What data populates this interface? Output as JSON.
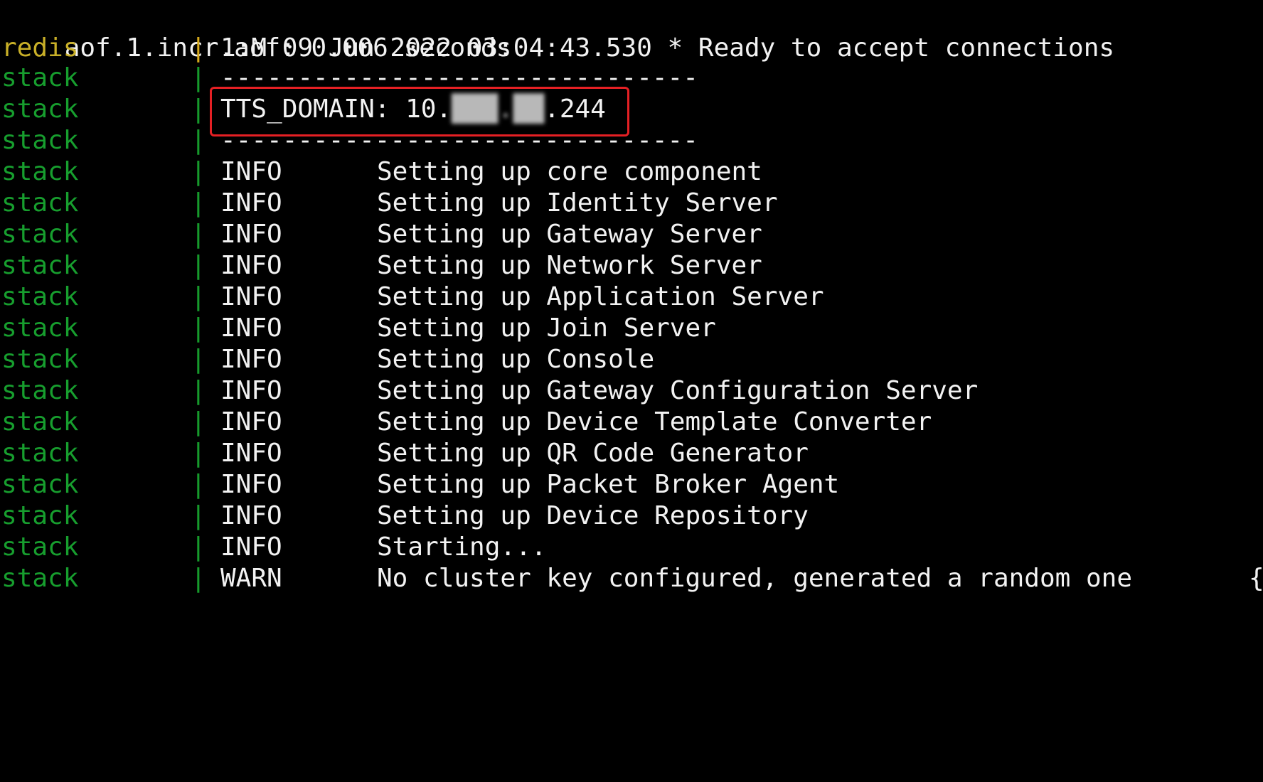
{
  "terminal": {
    "header_line": "aof.1.incr.aof: 0.006 seconds",
    "redis_line": {
      "service": "redis",
      "pipe": "|",
      "message": "1:M 09 Jun 2022 03:04:43.530 * Ready to accept connections"
    },
    "separator_top": {
      "service": "stack",
      "pipe": "|",
      "text": "-------------------------------"
    },
    "tts_line": {
      "service": "stack",
      "pipe": "|",
      "label": "TTS_DOMAIN: 10.",
      "redacted": "███.██",
      "suffix": ".244"
    },
    "separator_bottom": {
      "service": "stack",
      "pipe": "|",
      "text": "-------------------------------"
    },
    "log_lines": [
      {
        "service": "stack",
        "pipe": "|",
        "level": "INFO",
        "message": "Setting up core component"
      },
      {
        "service": "stack",
        "pipe": "|",
        "level": "INFO",
        "message": "Setting up Identity Server"
      },
      {
        "service": "stack",
        "pipe": "|",
        "level": "INFO",
        "message": "Setting up Gateway Server"
      },
      {
        "service": "stack",
        "pipe": "|",
        "level": "INFO",
        "message": "Setting up Network Server"
      },
      {
        "service": "stack",
        "pipe": "|",
        "level": "INFO",
        "message": "Setting up Application Server"
      },
      {
        "service": "stack",
        "pipe": "|",
        "level": "INFO",
        "message": "Setting up Join Server"
      },
      {
        "service": "stack",
        "pipe": "|",
        "level": "INFO",
        "message": "Setting up Console"
      },
      {
        "service": "stack",
        "pipe": "|",
        "level": "INFO",
        "message": "Setting up Gateway Configuration Server"
      },
      {
        "service": "stack",
        "pipe": "|",
        "level": "INFO",
        "message": "Setting up Device Template Converter"
      },
      {
        "service": "stack",
        "pipe": "|",
        "level": "INFO",
        "message": "Setting up QR Code Generator"
      },
      {
        "service": "stack",
        "pipe": "|",
        "level": "INFO",
        "message": "Setting up Packet Broker Agent"
      },
      {
        "service": "stack",
        "pipe": "|",
        "level": "INFO",
        "message": "Setting up Device Repository"
      },
      {
        "service": "stack",
        "pipe": "|",
        "level": "INFO",
        "message": "Starting..."
      },
      {
        "service": "stack",
        "pipe": "|",
        "level": "WARN",
        "message": "No cluster key configured, generated a random one",
        "overflow": "{"
      }
    ]
  },
  "colors": {
    "background": "#000000",
    "text": "#f2f2f2",
    "redis_service": "#c9b028",
    "stack_service": "#179e2e",
    "highlight_box": "#e52024"
  }
}
